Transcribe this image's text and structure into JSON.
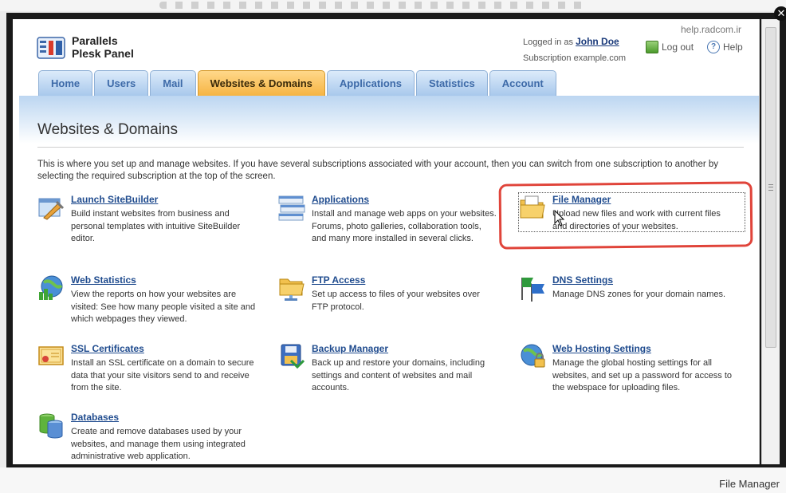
{
  "header": {
    "help_site": "help.radcom.ir",
    "logo_line1": "Parallels",
    "logo_line2": "Plesk Panel",
    "logged_in_prefix": "Logged in as",
    "user_name": "John Doe",
    "subscription_label": "Subscription example.com",
    "logout_label": "Log out",
    "help_label": "Help"
  },
  "tabs": [
    {
      "label": "Home"
    },
    {
      "label": "Users"
    },
    {
      "label": "Mail"
    },
    {
      "label": "Websites & Domains"
    },
    {
      "label": "Applications"
    },
    {
      "label": "Statistics"
    },
    {
      "label": "Account"
    }
  ],
  "page": {
    "title": "Websites & Domains",
    "intro": "This is where you set up and manage websites. If you have several subscriptions associated with your account, then you can switch from one subscription to another by selecting the required subscription at the top of the screen."
  },
  "items": [
    {
      "title": "Launch SiteBuilder",
      "desc": "Build instant websites from business and personal templates with intuitive SiteBuilder editor.",
      "icon": "sitebuilder-icon"
    },
    {
      "title": "Applications",
      "desc": "Install and manage web apps on your websites. Forums, photo galleries, collaboration tools, and many more installed in several clicks.",
      "icon": "applications-icon"
    },
    {
      "title": "File Manager",
      "desc": "Upload new files and work with current files and directories of your websites.",
      "icon": "folder-icon"
    },
    {
      "title": "Web Statistics",
      "desc": "View the reports on how your websites are visited: See how many people visited a site and which webpages they viewed.",
      "icon": "globe-chart-icon"
    },
    {
      "title": "FTP Access",
      "desc": "Set up access to files of your websites over FTP protocol.",
      "icon": "ftp-folder-icon"
    },
    {
      "title": "DNS Settings",
      "desc": "Manage DNS zones for your domain names.",
      "icon": "flags-icon"
    },
    {
      "title": "SSL Certificates",
      "desc": "Install an SSL certificate on a domain to secure data that your site visitors send to and receive from the site.",
      "icon": "certificate-icon"
    },
    {
      "title": "Backup Manager",
      "desc": "Back up and restore your domains, including settings and content of websites and mail accounts.",
      "icon": "floppy-icon"
    },
    {
      "title": "Web Hosting Settings",
      "desc": "Manage the global hosting settings for all websites, and set up a password for access to the webspace for uploading files.",
      "icon": "globe-lock-icon"
    },
    {
      "title": "Databases",
      "desc": "Create and remove databases used by your websites, and manage them using integrated administrative web application.",
      "icon": "database-icon"
    }
  ],
  "footer": {
    "status_label": "File Manager"
  },
  "colors": {
    "active_tab": "#f6b443",
    "tab": "#a8c8ec",
    "link": "#1f4b8e",
    "highlight": "#e0443a"
  }
}
